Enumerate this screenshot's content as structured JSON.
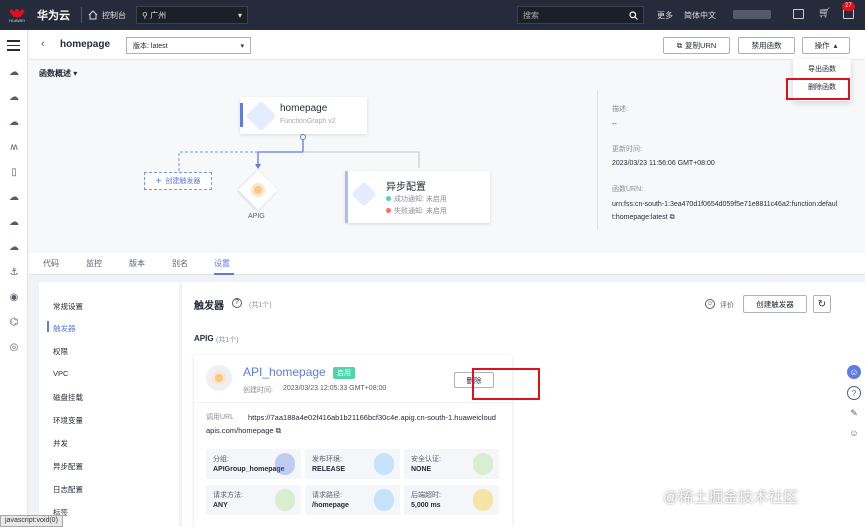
{
  "topbar": {
    "brand": "华为云",
    "logo_text": "HUAWEI",
    "console": "控制台",
    "region": "广州",
    "search_placeholder": "搜索",
    "more": "更多",
    "language": "简体中文",
    "notification_count": "27"
  },
  "header": {
    "function_name": "homepage",
    "version": "版本: latest",
    "copy_urn": "复制URN",
    "disable_function": "禁用函数",
    "operations": "操作"
  },
  "dropdown": {
    "items": [
      "导出函数",
      "删除函数"
    ]
  },
  "overview": {
    "title": "函数概述",
    "node_main_title": "homepage",
    "node_main_sub": "FunctionGraph v2",
    "add_trigger": "创建触发器",
    "apig_label": "APIG",
    "async_title": "异步配置",
    "async_success": "成功通知: 未启用",
    "async_failure": "失败通知: 未启用",
    "desc_label": "描述:",
    "desc_value": "--",
    "updated_label": "更新时间:",
    "updated_value": "2023/03/23 11:56:06 GMT+08:00",
    "urn_label": "函数URN:",
    "urn_value": "urn:fss:cn-south-1:3ea470d1f0654d059f5e71e8811c46a2:function:default:homepage:latest"
  },
  "tabs": [
    "代码",
    "监控",
    "版本",
    "别名",
    "设置"
  ],
  "settings_nav": [
    "常规设置",
    "触发器",
    "权限",
    "VPC",
    "磁盘挂载",
    "环境变量",
    "并发",
    "异步配置",
    "日志配置",
    "标签"
  ],
  "triggers": {
    "title": "触发器",
    "count": "(共1个)",
    "rate": "评价",
    "create_button": "创建触发器",
    "group_title": "APIG",
    "group_count": "(共1个)",
    "card": {
      "name": "API_homepage",
      "status": "启用",
      "created_label": "创建时间:",
      "created_value": "2023/03/23 12:05:33 GMT+08:00",
      "delete_button": "删除",
      "url_label": "调用URL",
      "url_value": "https://7aa188a4e02f416ab1b21166bcf30c4e.apig.cn-south-1.huaweicloudapis.com/homepage",
      "cells": [
        {
          "k": "分组:",
          "v": "APIGroup_homepage"
        },
        {
          "k": "发布环境:",
          "v": "RELEASE"
        },
        {
          "k": "安全认证:",
          "v": "NONE"
        },
        {
          "k": "请求方法:",
          "v": "ANY"
        },
        {
          "k": "请求路径:",
          "v": "/homepage"
        },
        {
          "k": "后端超时:",
          "v": "5,000 ms"
        }
      ]
    }
  },
  "watermark": "@稀土掘金技术社区",
  "statusbar": "javascript:void(0)",
  "colors": {
    "accent": "#5e7ce0",
    "danger": "#e0101f",
    "success": "#50d4ab",
    "topbar": "#252b3a"
  }
}
